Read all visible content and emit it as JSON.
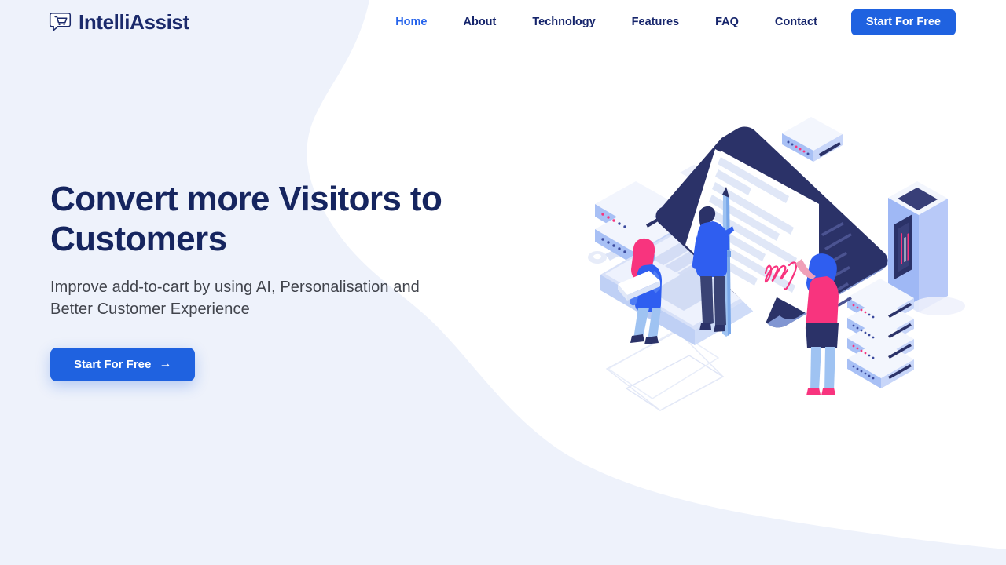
{
  "brand": {
    "name": "IntelliAssist",
    "icon": "chat-cart-icon"
  },
  "nav": {
    "items": [
      {
        "label": "Home",
        "active": true
      },
      {
        "label": "About",
        "active": false
      },
      {
        "label": "Technology",
        "active": false
      },
      {
        "label": "Features",
        "active": false
      },
      {
        "label": "FAQ",
        "active": false
      },
      {
        "label": "Contact",
        "active": false
      }
    ],
    "cta_label": "Start For Free"
  },
  "hero": {
    "title": "Convert more Visitors to\nCustomers",
    "subtitle": "Improve add-to-cart by using AI, Personalisation and\nBetter Customer Experience",
    "cta_label": "Start For Free",
    "cta_arrow": "→"
  },
  "illustration": {
    "name": "isometric-document-signing-illustration",
    "elements": [
      "laptop",
      "document-with-signature",
      "giant-pen",
      "man-signing",
      "woman-with-pink-hair-seated",
      "woman-with-blue-hair-standing",
      "server-rack-left",
      "server-rack-right",
      "server-tower",
      "network-switch",
      "key",
      "outline-diamond"
    ]
  },
  "colors": {
    "background_left": "#eef2fb",
    "background_right": "#ffffff",
    "brand_navy": "#1b2a6b",
    "accent_blue": "#1f62e0",
    "nav_active": "#2563eb",
    "heading_navy": "#16255f",
    "body_gray": "#41444c",
    "illustration_navy": "#2b3268",
    "illustration_blue": "#2f5ef0",
    "illustration_light_blue": "#9fb8f5",
    "illustration_pale": "#e6ebf8",
    "illustration_pink": "#f8347e"
  }
}
